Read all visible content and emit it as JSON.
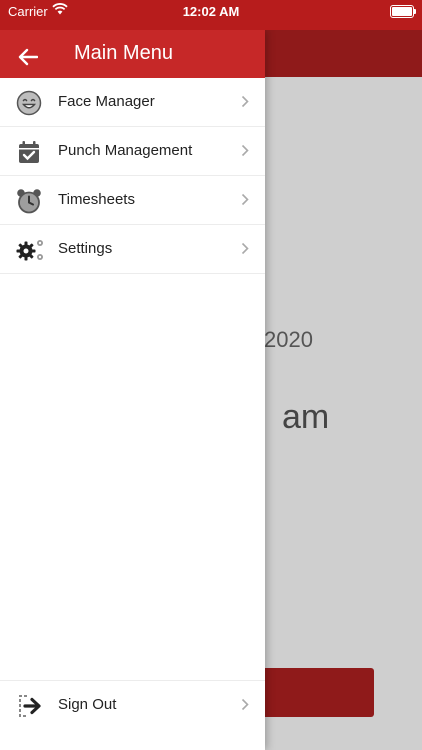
{
  "status_bar": {
    "carrier": "Carrier",
    "time": "12:02 AM"
  },
  "drawer": {
    "title": "Main Menu",
    "items": [
      {
        "label": "Face Manager",
        "icon": "smiley-face-icon"
      },
      {
        "label": "Punch Management",
        "icon": "calendar-check-icon"
      },
      {
        "label": "Timesheets",
        "icon": "alarm-clock-icon"
      },
      {
        "label": "Settings",
        "icon": "gears-icon"
      }
    ],
    "sign_out": {
      "label": "Sign Out",
      "icon": "sign-out-icon"
    }
  },
  "background": {
    "date_fragment": "2020",
    "time_fragment": "am"
  },
  "colors": {
    "primary": "#c62828",
    "dark_primary": "#8f1a1a",
    "overlay": "#cfcfcf"
  }
}
